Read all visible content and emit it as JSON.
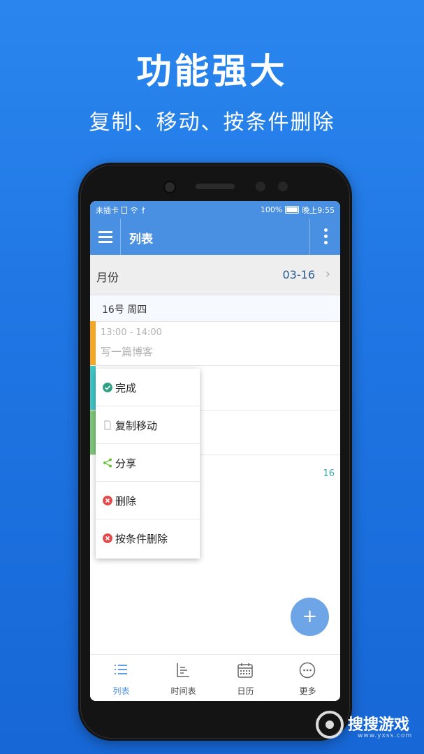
{
  "promo": {
    "headline": "功能强大",
    "subline": "复制、移动、按条件删除"
  },
  "status_bar": {
    "carrier": "未插卡",
    "battery": "100%",
    "time": "晚上9:55"
  },
  "app_bar": {
    "title": "列表"
  },
  "month_row": {
    "label": "月份",
    "value": "03-16"
  },
  "day_header": "16号 周四",
  "events": [
    {
      "time": "13:00 - 14:00",
      "title": "写一篇博客",
      "color": "#f5a623"
    },
    {
      "time": "",
      "title": "",
      "color": "#3fc6c8"
    },
    {
      "time": "",
      "title": "",
      "color": "#7ec87a"
    }
  ],
  "right_number": "16",
  "context_menu": {
    "items": [
      {
        "label": "完成",
        "icon": "check-circle-icon",
        "color": "#2fa084"
      },
      {
        "label": "复制移动",
        "icon": "document-icon",
        "color": "#bdbdbd"
      },
      {
        "label": "分享",
        "icon": "share-icon",
        "color": "#6fc13c"
      },
      {
        "label": "删除",
        "icon": "close-circle-icon",
        "color": "#e24a4a"
      },
      {
        "label": "按条件删除",
        "icon": "close-circle-icon",
        "color": "#e24a4a"
      }
    ]
  },
  "fab": {
    "label": "+"
  },
  "bottom_nav": {
    "items": [
      {
        "label": "列表",
        "icon": "list-icon",
        "active": true
      },
      {
        "label": "时间表",
        "icon": "timeline-icon",
        "active": false
      },
      {
        "label": "日历",
        "icon": "calendar-icon",
        "active": false
      },
      {
        "label": "更多",
        "icon": "more-circle-icon",
        "active": false
      }
    ]
  },
  "colors": {
    "primary": "#4a90e2",
    "background_top": "#2a86ee",
    "active_nav": "#4a90e2"
  },
  "watermark": {
    "name": "搜搜游戏",
    "url": "www.yxss.com"
  }
}
